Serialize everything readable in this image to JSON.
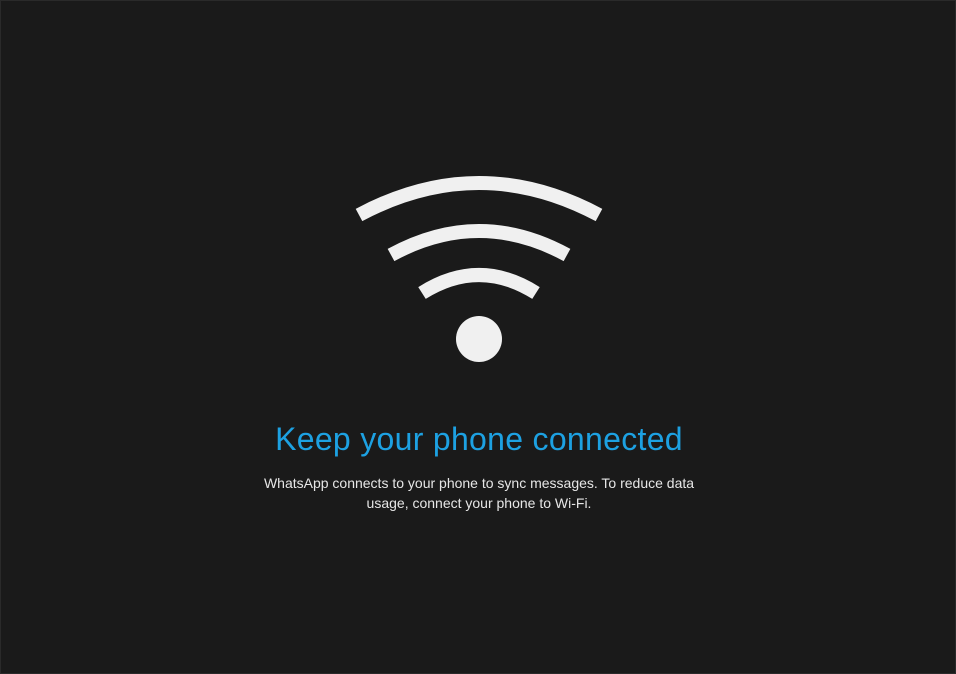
{
  "colors": {
    "background": "#1a1a1a",
    "accent": "#1da1e2",
    "icon": "#f0f0f0",
    "text": "#e6e6e6"
  },
  "icon": {
    "name": "wifi-icon"
  },
  "main": {
    "title": "Keep your phone connected",
    "description": "WhatsApp connects to your phone to sync messages. To reduce data usage, connect your phone to Wi-Fi."
  }
}
